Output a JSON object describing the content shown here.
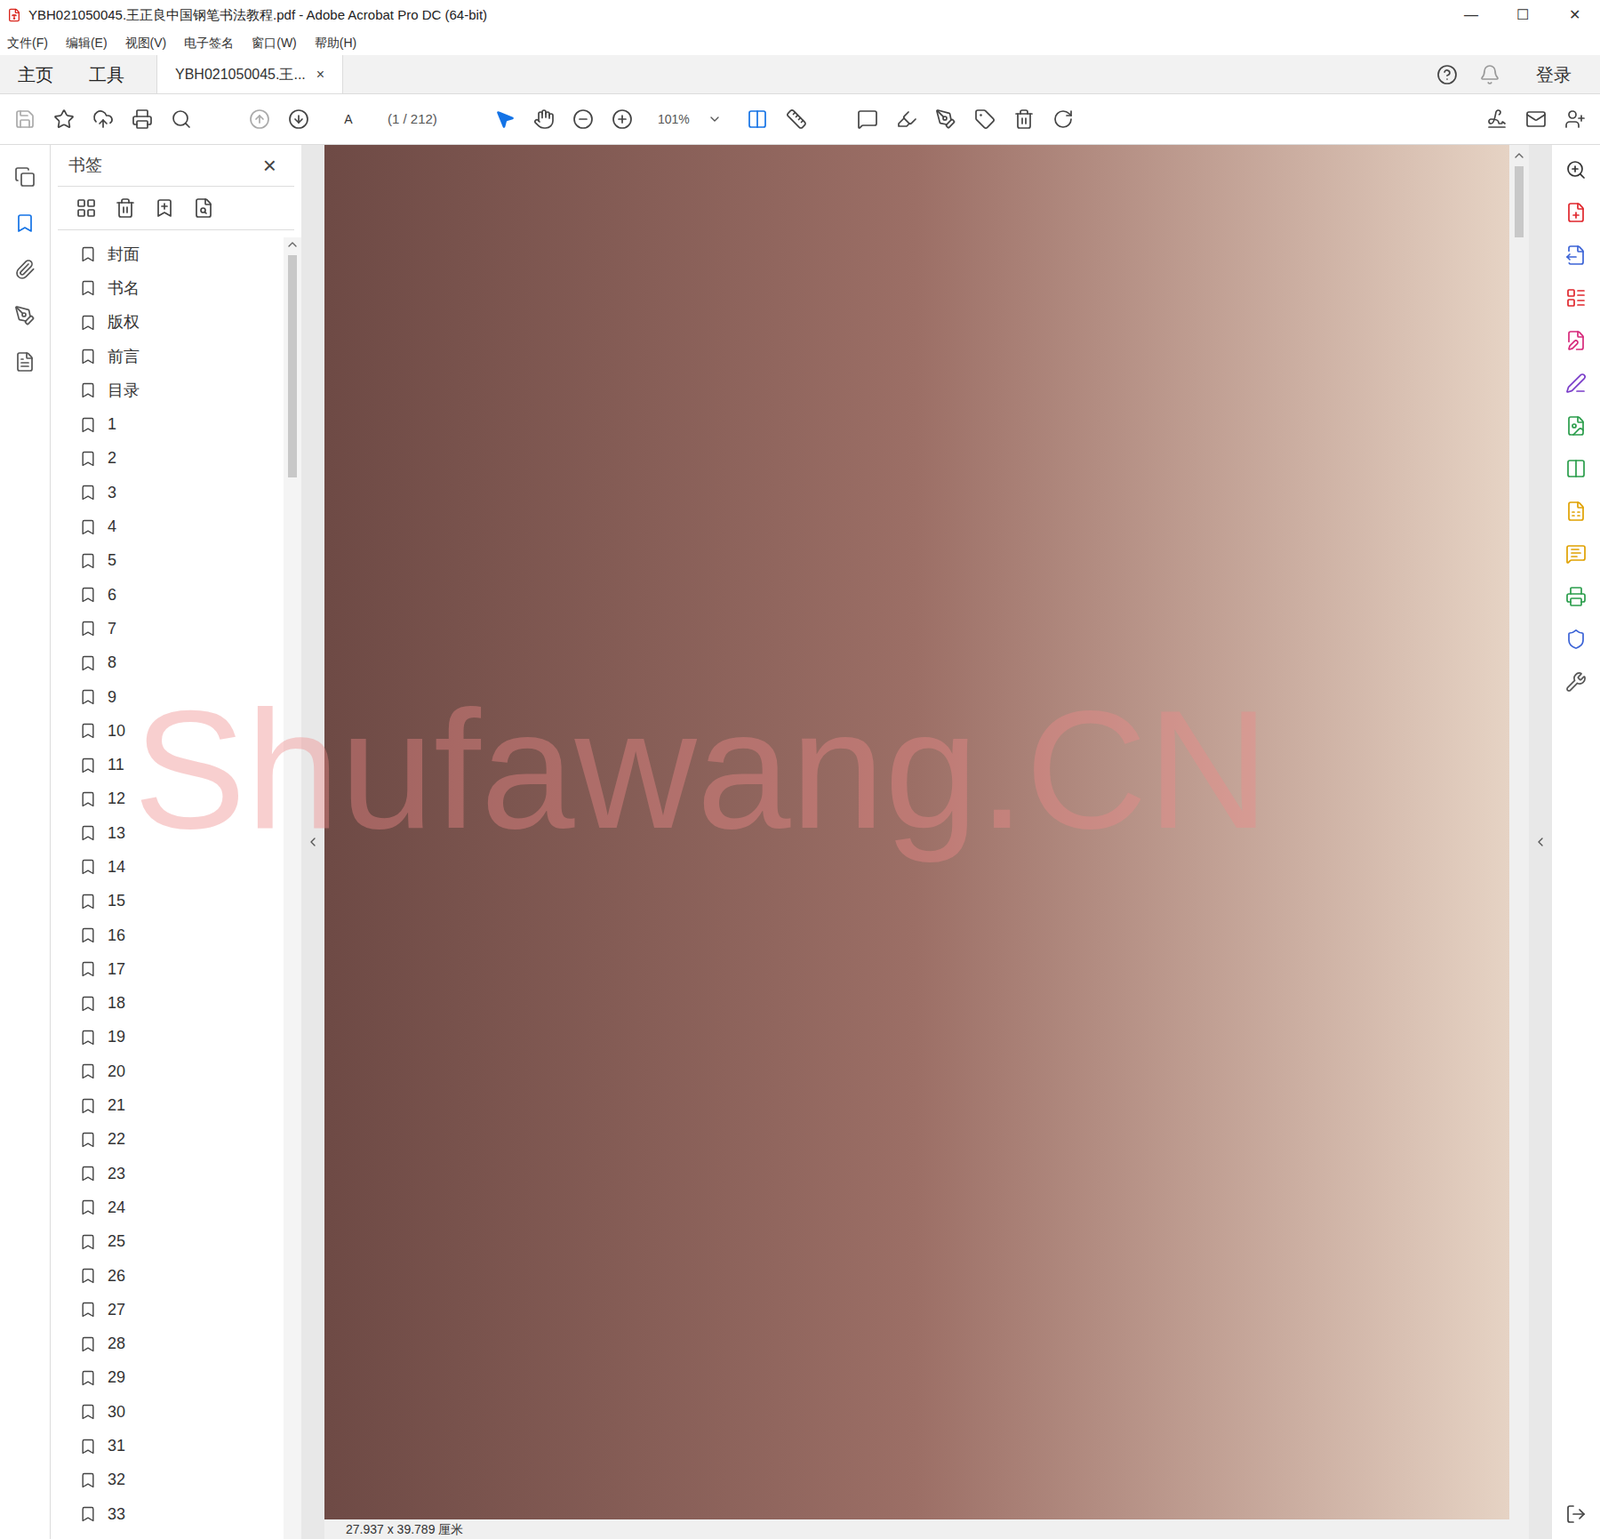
{
  "window": {
    "title": "YBH021050045.王正良中国钢笔书法教程.pdf - Adobe Acrobat Pro DC (64-bit)",
    "controls": [
      "—",
      "☐",
      "✕"
    ]
  },
  "menu": [
    "文件(F)",
    "编辑(E)",
    "视图(V)",
    "电子签名",
    "窗口(W)",
    "帮助(H)"
  ],
  "tabs": [
    {
      "label": "主页",
      "selected": false
    },
    {
      "label": "工具",
      "selected": false
    },
    {
      "label": "YBH021050045.王...",
      "selected": true,
      "close": "×"
    }
  ],
  "sign_in": "登录",
  "toolbar": {
    "page_input": "A",
    "page_count": "(1 / 212)",
    "zoom": "101%"
  },
  "bookmarks": {
    "title": "书签",
    "close": "×",
    "items": [
      "封面",
      "书名",
      "版权",
      "前言",
      "目录",
      "1",
      "2",
      "3",
      "4",
      "5",
      "6",
      "7",
      "8",
      "9",
      "10",
      "11",
      "12",
      "13",
      "14",
      "15",
      "16",
      "17",
      "18",
      "19",
      "20",
      "21",
      "22",
      "23",
      "24",
      "25",
      "26",
      "27",
      "28",
      "29",
      "30",
      "31",
      "32",
      "33"
    ]
  },
  "page_size": "27.937 x 39.789 厘米",
  "watermark": "Shufawang.CN"
}
